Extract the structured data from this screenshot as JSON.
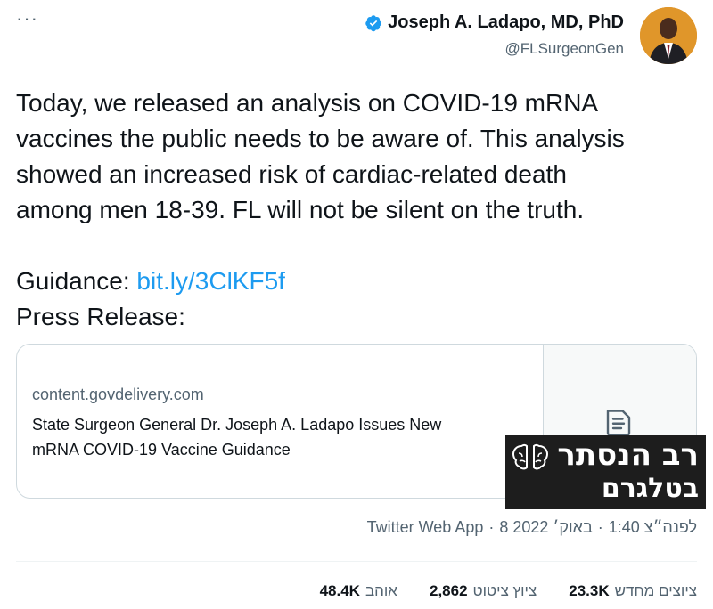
{
  "header": {
    "more_label": "···",
    "author_name": "Joseph A. Ladapo, MD, PhD",
    "author_handle": "@FLSurgeonGen"
  },
  "tweet": {
    "line1": "Today, we released an analysis on COVID-19 mRNA",
    "line2": "vaccines the public needs to be aware of. This analysis",
    "line3": "showed an increased risk of cardiac-related death",
    "line4": "among men 18-39. FL will not be silent on the truth.",
    "guidance_label": "Guidance:",
    "guidance_link": "bit.ly/3ClKF5f",
    "press_label": "Press Release:"
  },
  "card": {
    "domain": "content.govdelivery.com",
    "title_line1": "State Surgeon General Dr. Joseph A. Ladapo Issues New",
    "title_line2": "mRNA COVID-19 Vaccine Guidance"
  },
  "overlay": {
    "line1": "רב הנסתר",
    "line2": "בטלגרם"
  },
  "meta": {
    "time": "1:40 לפנה״צ",
    "date": "8 באוק׳ 2022",
    "source": "Twitter Web App",
    "separator": "·"
  },
  "stats": {
    "retweets_count": "23.3K",
    "retweets_label": "ציוצים מחדש",
    "quotes_count": "2,862",
    "quotes_label": "ציוץ ציטוט",
    "likes_count": "48.4K",
    "likes_label": "אוהב"
  },
  "colors": {
    "link": "#1d9bf0",
    "muted": "#536471",
    "verified": "#1d9bf0"
  }
}
